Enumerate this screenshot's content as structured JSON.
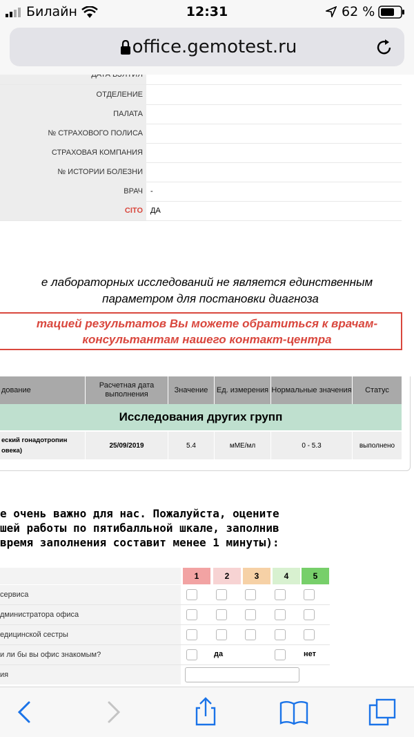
{
  "status_bar": {
    "carrier": "Билайн",
    "time": "12:31",
    "battery": "62 %"
  },
  "browser": {
    "url": "office.gemotest.ru"
  },
  "patient_info": [
    {
      "label": "ДАТА ВЗЯТИЯ",
      "value": ""
    },
    {
      "label": "ОТДЕЛЕНИЕ",
      "value": ""
    },
    {
      "label": "ПАЛАТА",
      "value": ""
    },
    {
      "label": "№ СТРАХОВОГО ПОЛИСА",
      "value": ""
    },
    {
      "label": "СТРАХОВАЯ КОМПАНИЯ",
      "value": ""
    },
    {
      "label": "№ ИСТОРИИ БОЛЕЗНИ",
      "value": ""
    },
    {
      "label": "ВРАЧ",
      "value": "-"
    },
    {
      "label": "CITO",
      "value": "ДА"
    }
  ],
  "disclaimer": {
    "line1": "е лабораторных исследований не является единственным",
    "line2": "параметром для постановки диагноза",
    "consult1": "тацией результатов Вы можете обратиться к врачам-",
    "consult2": "консультантам нашего контакт-центра"
  },
  "results": {
    "headers": [
      "дование",
      "Расчетная дата выполнения",
      "Значение",
      "Ед. измерения",
      "Нормальные значения",
      "Статус"
    ],
    "group": "Исследования других групп",
    "rows": [
      {
        "name1": "еский гонадотропин",
        "name2": "овека)",
        "date": "25/09/2019",
        "value": "5.4",
        "unit": "мМЕ/мл",
        "norm": "0 - 5.3",
        "status": "выполнено"
      }
    ]
  },
  "rating": {
    "heading1": "е очень важно для нас. Пожалуйста, оцените",
    "heading2": "шей работы по пятибалльной шкале, заполнив",
    "heading3": "время заполнения составит менее 1 минуты):",
    "scale": [
      "1",
      "2",
      "3",
      "4",
      "5"
    ],
    "scale_colors": [
      "#f2a3a3",
      "#f7d3d3",
      "#f6d1a6",
      "#d8f1d0",
      "#77cf6a"
    ],
    "questions": [
      "сервиса",
      "дминистратора офиса",
      "едицинской сестры"
    ],
    "recommend_label": "и ли бы вы офис знакомым?",
    "yes": "да",
    "no": "нет",
    "comment_label": "ия"
  },
  "toolbar": {
    "items": [
      "back",
      "forward",
      "share",
      "bookmarks",
      "tabs"
    ]
  }
}
